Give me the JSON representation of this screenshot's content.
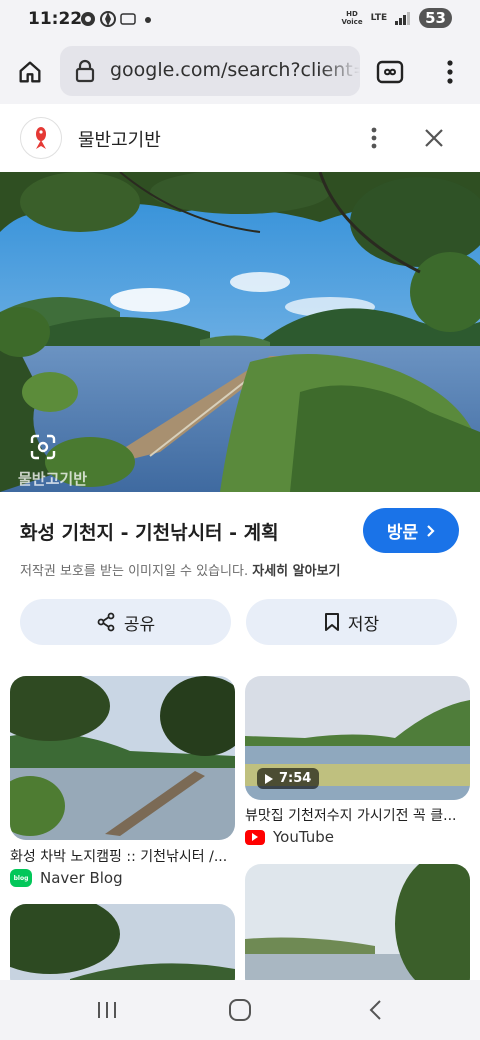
{
  "status": {
    "time": "11:22",
    "hd_voice": "HD\nVoice",
    "lte": "LTE",
    "battery": "53"
  },
  "browser": {
    "url": "google.com/search?client=fire"
  },
  "source": {
    "name": "물반고기반"
  },
  "image": {
    "watermark": "물반고기반",
    "title": "화성 기천지 - 기천낚시터 - 계획"
  },
  "visit_label": "방문",
  "copyright": {
    "text": "저작권 보호를 받는 이미지일 수 있습니다.",
    "link": "자세히 알아보기"
  },
  "actions": {
    "share": "공유",
    "save": "저장"
  },
  "related": [
    {
      "title": "화성 차박 노지캠핑 :: 기천낚시터 /...",
      "source": "Naver Blog",
      "source_icon": "blog-icon"
    },
    {
      "title": "뷰맛집 기천저수지 가시기전 꼭 클...",
      "source": "YouTube",
      "source_icon": "youtube-icon",
      "duration": "7:54"
    }
  ],
  "colors": {
    "accent": "#1a73e8",
    "chip_bg": "#e8eef8",
    "bar_bg": "#f3f3f6",
    "naver": "#03c75a",
    "youtube": "#ff0000"
  }
}
